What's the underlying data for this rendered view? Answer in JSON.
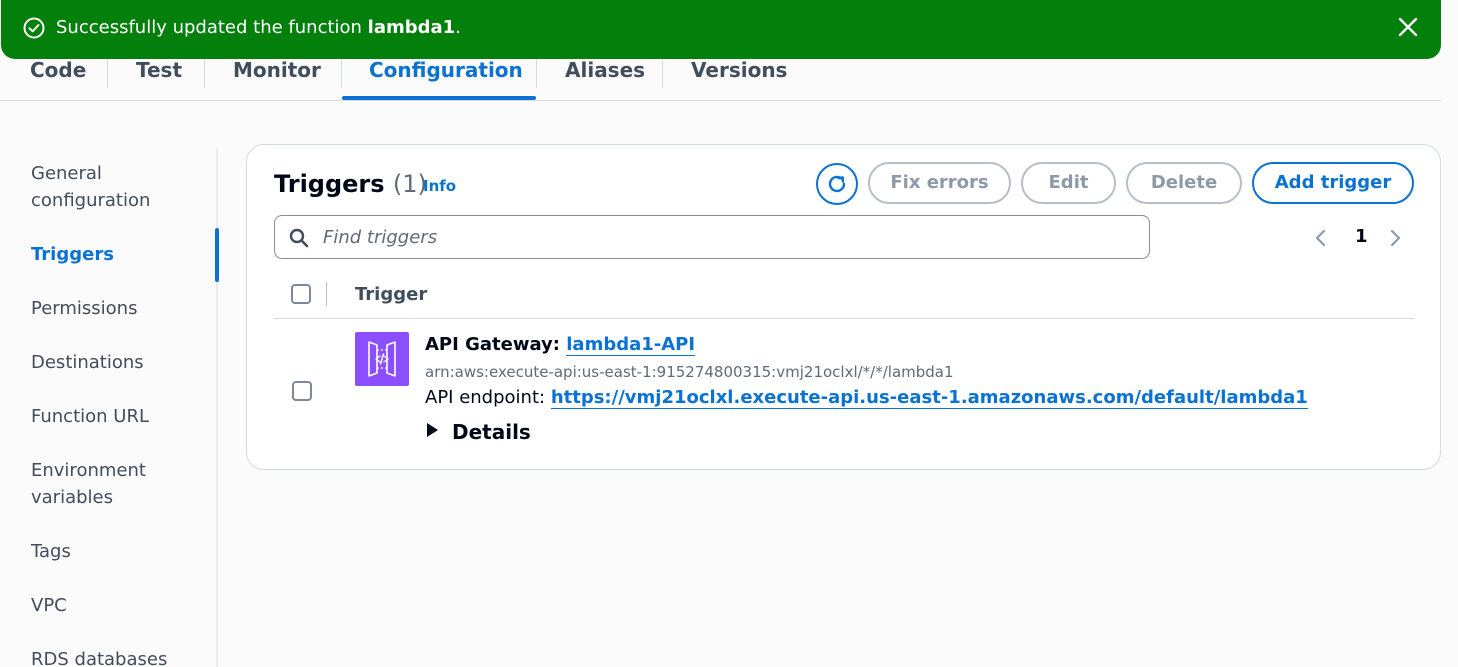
{
  "flash": {
    "message_prefix": "Successfully updated the function ",
    "function_name": "lambda1",
    "message_suffix": ".",
    "color": "#037f0c"
  },
  "tabs": [
    {
      "label": "Code"
    },
    {
      "label": "Test"
    },
    {
      "label": "Monitor"
    },
    {
      "label": "Configuration",
      "active": true
    },
    {
      "label": "Aliases"
    },
    {
      "label": "Versions"
    }
  ],
  "sidenav": {
    "items": [
      {
        "label": "General configuration"
      },
      {
        "label": "Triggers",
        "active": true
      },
      {
        "label": "Permissions"
      },
      {
        "label": "Destinations"
      },
      {
        "label": "Function URL"
      },
      {
        "label": "Environment variables"
      },
      {
        "label": "Tags"
      },
      {
        "label": "VPC"
      },
      {
        "label": "RDS databases"
      }
    ]
  },
  "triggers": {
    "title": "Triggers",
    "count": "(1)",
    "info_label": "Info",
    "buttons": {
      "fix_errors": "Fix errors",
      "edit": "Edit",
      "delete": "Delete",
      "add_trigger": "Add trigger"
    },
    "search_placeholder": "Find triggers",
    "page": "1",
    "column_header": "Trigger",
    "rows": [
      {
        "service": "API Gateway: ",
        "name": "lambda1-API",
        "arn": "arn:aws:execute-api:us-east-1:915274800315:vmj21oclxl/*/*/lambda1",
        "endpoint_label": "API endpoint: ",
        "endpoint_url": "https://vmj21oclxl.execute-api.us-east-1.amazonaws.com/default/lambda1",
        "details_label": "Details"
      }
    ]
  },
  "colors": {
    "accent": "#0972d3",
    "success": "#037f0c",
    "api_gateway": "#8c4fff"
  }
}
